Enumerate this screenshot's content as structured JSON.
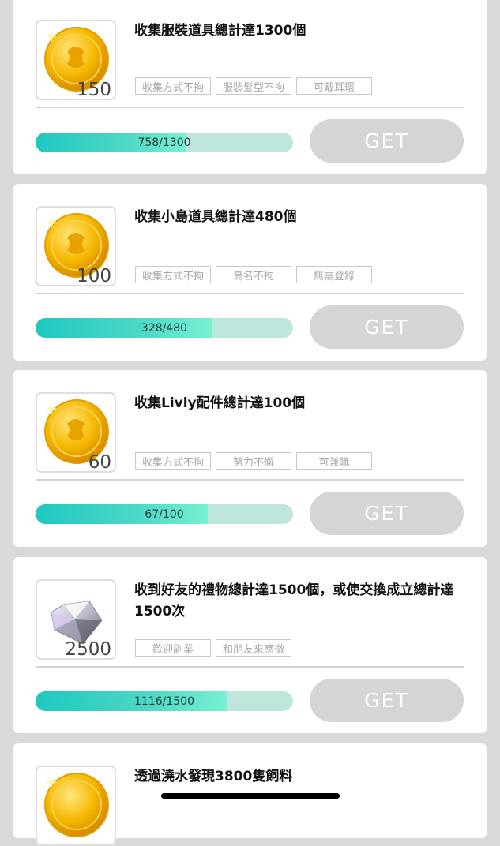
{
  "colors": {
    "background": "#d9d9d9",
    "card": "#ffffff",
    "progress_fill": "#1ec8c0",
    "progress_track": "#bfe6dc",
    "button_disabled": "#d5d5d5"
  },
  "missions": [
    {
      "title": "收集服裝道具總計達1300個",
      "reward_icon": "gold-coin-icon",
      "reward_amount": "150",
      "tags": [
        "收集方式不拘",
        "服裝髮型不拘",
        "可戴耳環"
      ],
      "progress_text": "758/1300",
      "progress_fraction": 0.583,
      "button_label": "GET"
    },
    {
      "title": "收集小島道具總計達480個",
      "reward_icon": "gold-coin-icon",
      "reward_amount": "100",
      "tags": [
        "收集方式不拘",
        "島名不拘",
        "無需登錄"
      ],
      "progress_text": "328/480",
      "progress_fraction": 0.683,
      "button_label": "GET"
    },
    {
      "title": "收集Livly配件總計達100個",
      "reward_icon": "gold-coin-icon",
      "reward_amount": "60",
      "tags": [
        "收集方式不拘",
        "努力不懈",
        "可兼職"
      ],
      "progress_text": "67/100",
      "progress_fraction": 0.67,
      "button_label": "GET"
    },
    {
      "title": "收到好友的禮物總計達1500個，或使交換成立總計達1500次",
      "reward_icon": "diamond-icon",
      "reward_amount": "2500",
      "tags": [
        "歡迎副業",
        "和朋友來應徵"
      ],
      "progress_text": "1116/1500",
      "progress_fraction": 0.744,
      "button_label": "GET"
    },
    {
      "title": "透過澆水發現3800隻飼料",
      "reward_icon": "gold-coin-icon"
    }
  ]
}
